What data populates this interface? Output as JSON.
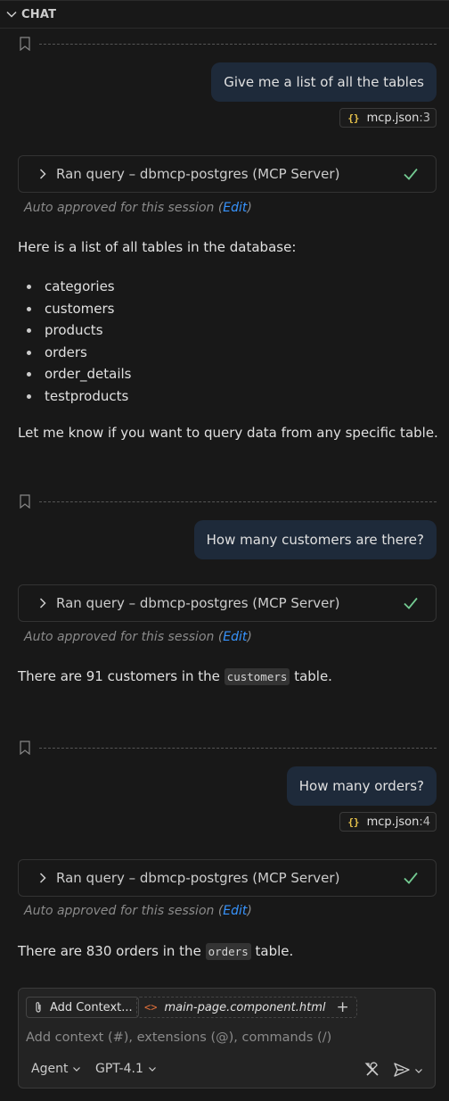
{
  "header": {
    "title": "CHAT"
  },
  "messages": [
    {
      "user": "Give me a list of all the tables",
      "ref": {
        "file": "mcp.json",
        "line": ":3"
      },
      "tool": "Ran query – dbmcp-postgres (MCP Server)",
      "approved_prefix": "Auto approved for this session (",
      "approved_link": "Edit",
      "approved_suffix": ")",
      "intro": "Here is a list of all tables in the database:",
      "tables": [
        "categories",
        "customers",
        "products",
        "orders",
        "order_details",
        "testproducts"
      ],
      "outro": "Let me know if you want to query data from any specific table."
    },
    {
      "user": "How many customers are there?",
      "tool": "Ran query – dbmcp-postgres (MCP Server)",
      "approved_prefix": "Auto approved for this session (",
      "approved_link": "Edit",
      "approved_suffix": ")",
      "answer_pre": "There are 91 customers in the",
      "answer_code": "customers",
      "answer_post": "table."
    },
    {
      "user": "How many orders?",
      "ref": {
        "file": "mcp.json",
        "line": ":4"
      },
      "tool": "Ran query – dbmcp-postgres (MCP Server)",
      "approved_prefix": "Auto approved for this session (",
      "approved_link": "Edit",
      "approved_suffix": ")",
      "answer_pre": "There are 830 orders in the",
      "answer_code": "orders",
      "answer_post": "table."
    }
  ],
  "input": {
    "add_context": "Add Context...",
    "attached_file": "main-page.component.html",
    "placeholder": "Add context (#), extensions (@), commands (/)",
    "mode": "Agent",
    "model": "GPT-4.1"
  },
  "colors": {
    "accent": "#3794ff",
    "check": "#73c991",
    "bubble": "#1e2a3a"
  }
}
